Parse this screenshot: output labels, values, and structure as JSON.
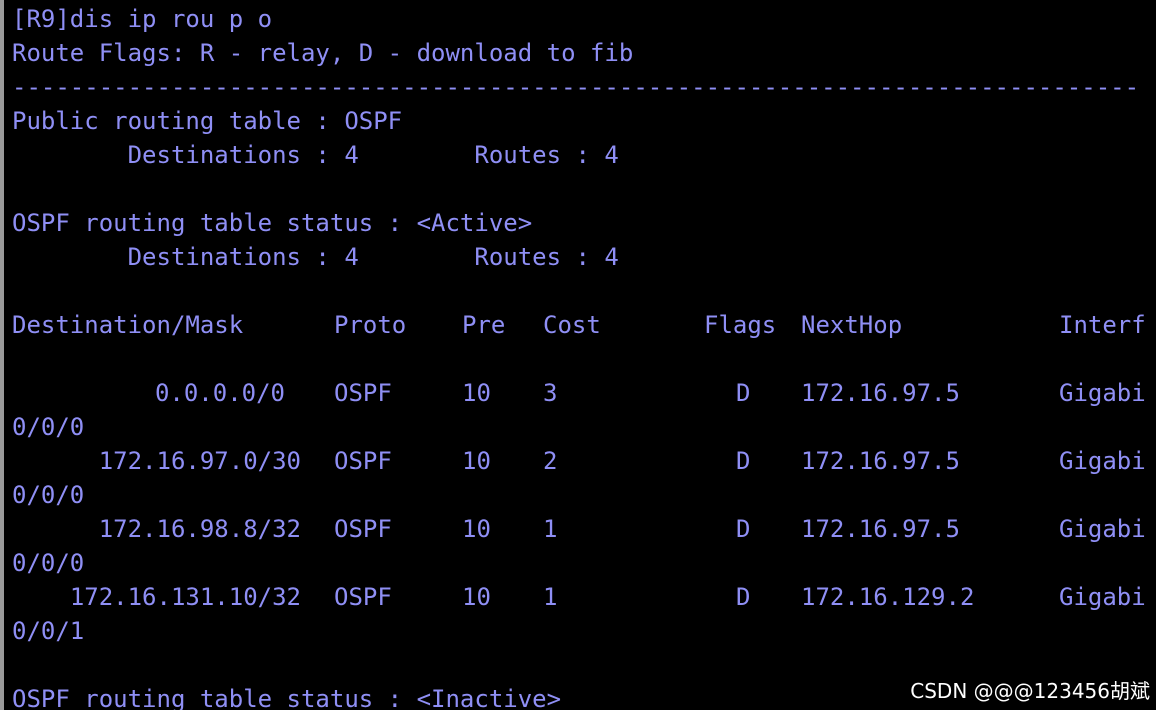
{
  "terminal": {
    "prompt": "[R9]dis ip rou p o",
    "flags_line": "Route Flags: R - relay, D - download to fib",
    "separator": "------------------------------------------------------------------------------",
    "public_table": "Public routing table : OSPF",
    "public_counts": "        Destinations : 4        Routes : 4",
    "active_status": "OSPF routing table status : <Active>",
    "active_counts": "        Destinations : 4        Routes : 4",
    "headers": {
      "destination": "Destination/Mask",
      "proto": "Proto",
      "pre": "Pre",
      "cost": "Cost",
      "flags": "Flags",
      "nexthop": "NextHop",
      "interface": "Interf"
    },
    "routes": [
      {
        "dest": "0.0.0.0/0",
        "proto": "OSPF",
        "pre": "10",
        "cost": "3",
        "flags": "D",
        "nexthop": "172.16.97.5",
        "iface": "Gigabi",
        "iface_cont": "0/0/0"
      },
      {
        "dest": "172.16.97.0/30",
        "proto": "OSPF",
        "pre": "10",
        "cost": "2",
        "flags": "D",
        "nexthop": "172.16.97.5",
        "iface": "Gigabi",
        "iface_cont": "0/0/0"
      },
      {
        "dest": "172.16.98.8/32",
        "proto": "OSPF",
        "pre": "10",
        "cost": "1",
        "flags": "D",
        "nexthop": "172.16.97.5",
        "iface": "Gigabi",
        "iface_cont": "0/0/0"
      },
      {
        "dest": "172.16.131.10/32",
        "proto": "OSPF",
        "pre": "10",
        "cost": "1",
        "flags": "D",
        "nexthop": "172.16.129.2",
        "iface": "Gigabi",
        "iface_cont": "0/0/1"
      }
    ],
    "inactive_status": "OSPF routing table status : <Inactive>"
  },
  "watermark": "CSDN @@@123456胡斌",
  "colors": {
    "background": "#000000",
    "text": "#8f8ff5"
  }
}
